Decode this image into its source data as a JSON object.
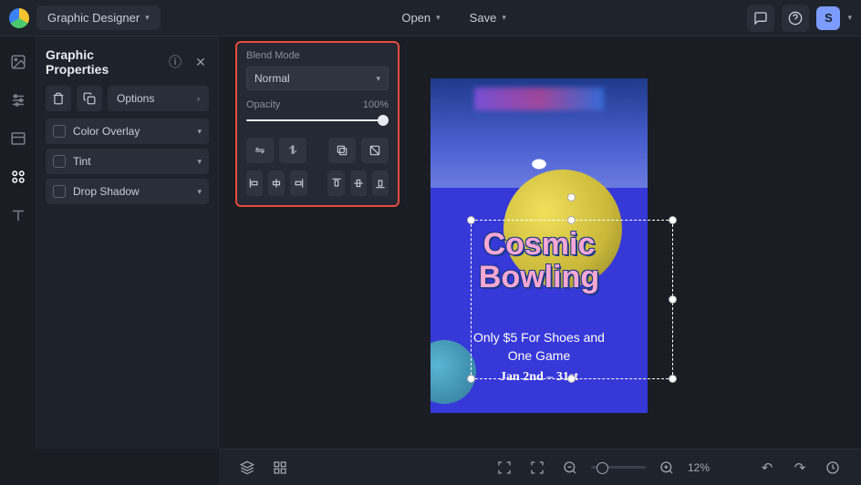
{
  "topbar": {
    "role": "Graphic Designer",
    "open": "Open",
    "save": "Save",
    "avatar": "S"
  },
  "panel": {
    "title": "Graphic Properties",
    "options": "Options",
    "props": [
      "Color Overlay",
      "Tint",
      "Drop Shadow"
    ]
  },
  "float": {
    "blend_label": "Blend Mode",
    "blend_value": "Normal",
    "opacity_label": "Opacity",
    "opacity_value": "100%"
  },
  "artwork": {
    "headline_1": "Cosmic",
    "headline_2": "Bowling",
    "sub1a": "Only $5 For Shoes and",
    "sub1b": "One Game",
    "sub2": "Jan 2nd – 31st"
  },
  "bottom": {
    "zoom": "12%"
  }
}
